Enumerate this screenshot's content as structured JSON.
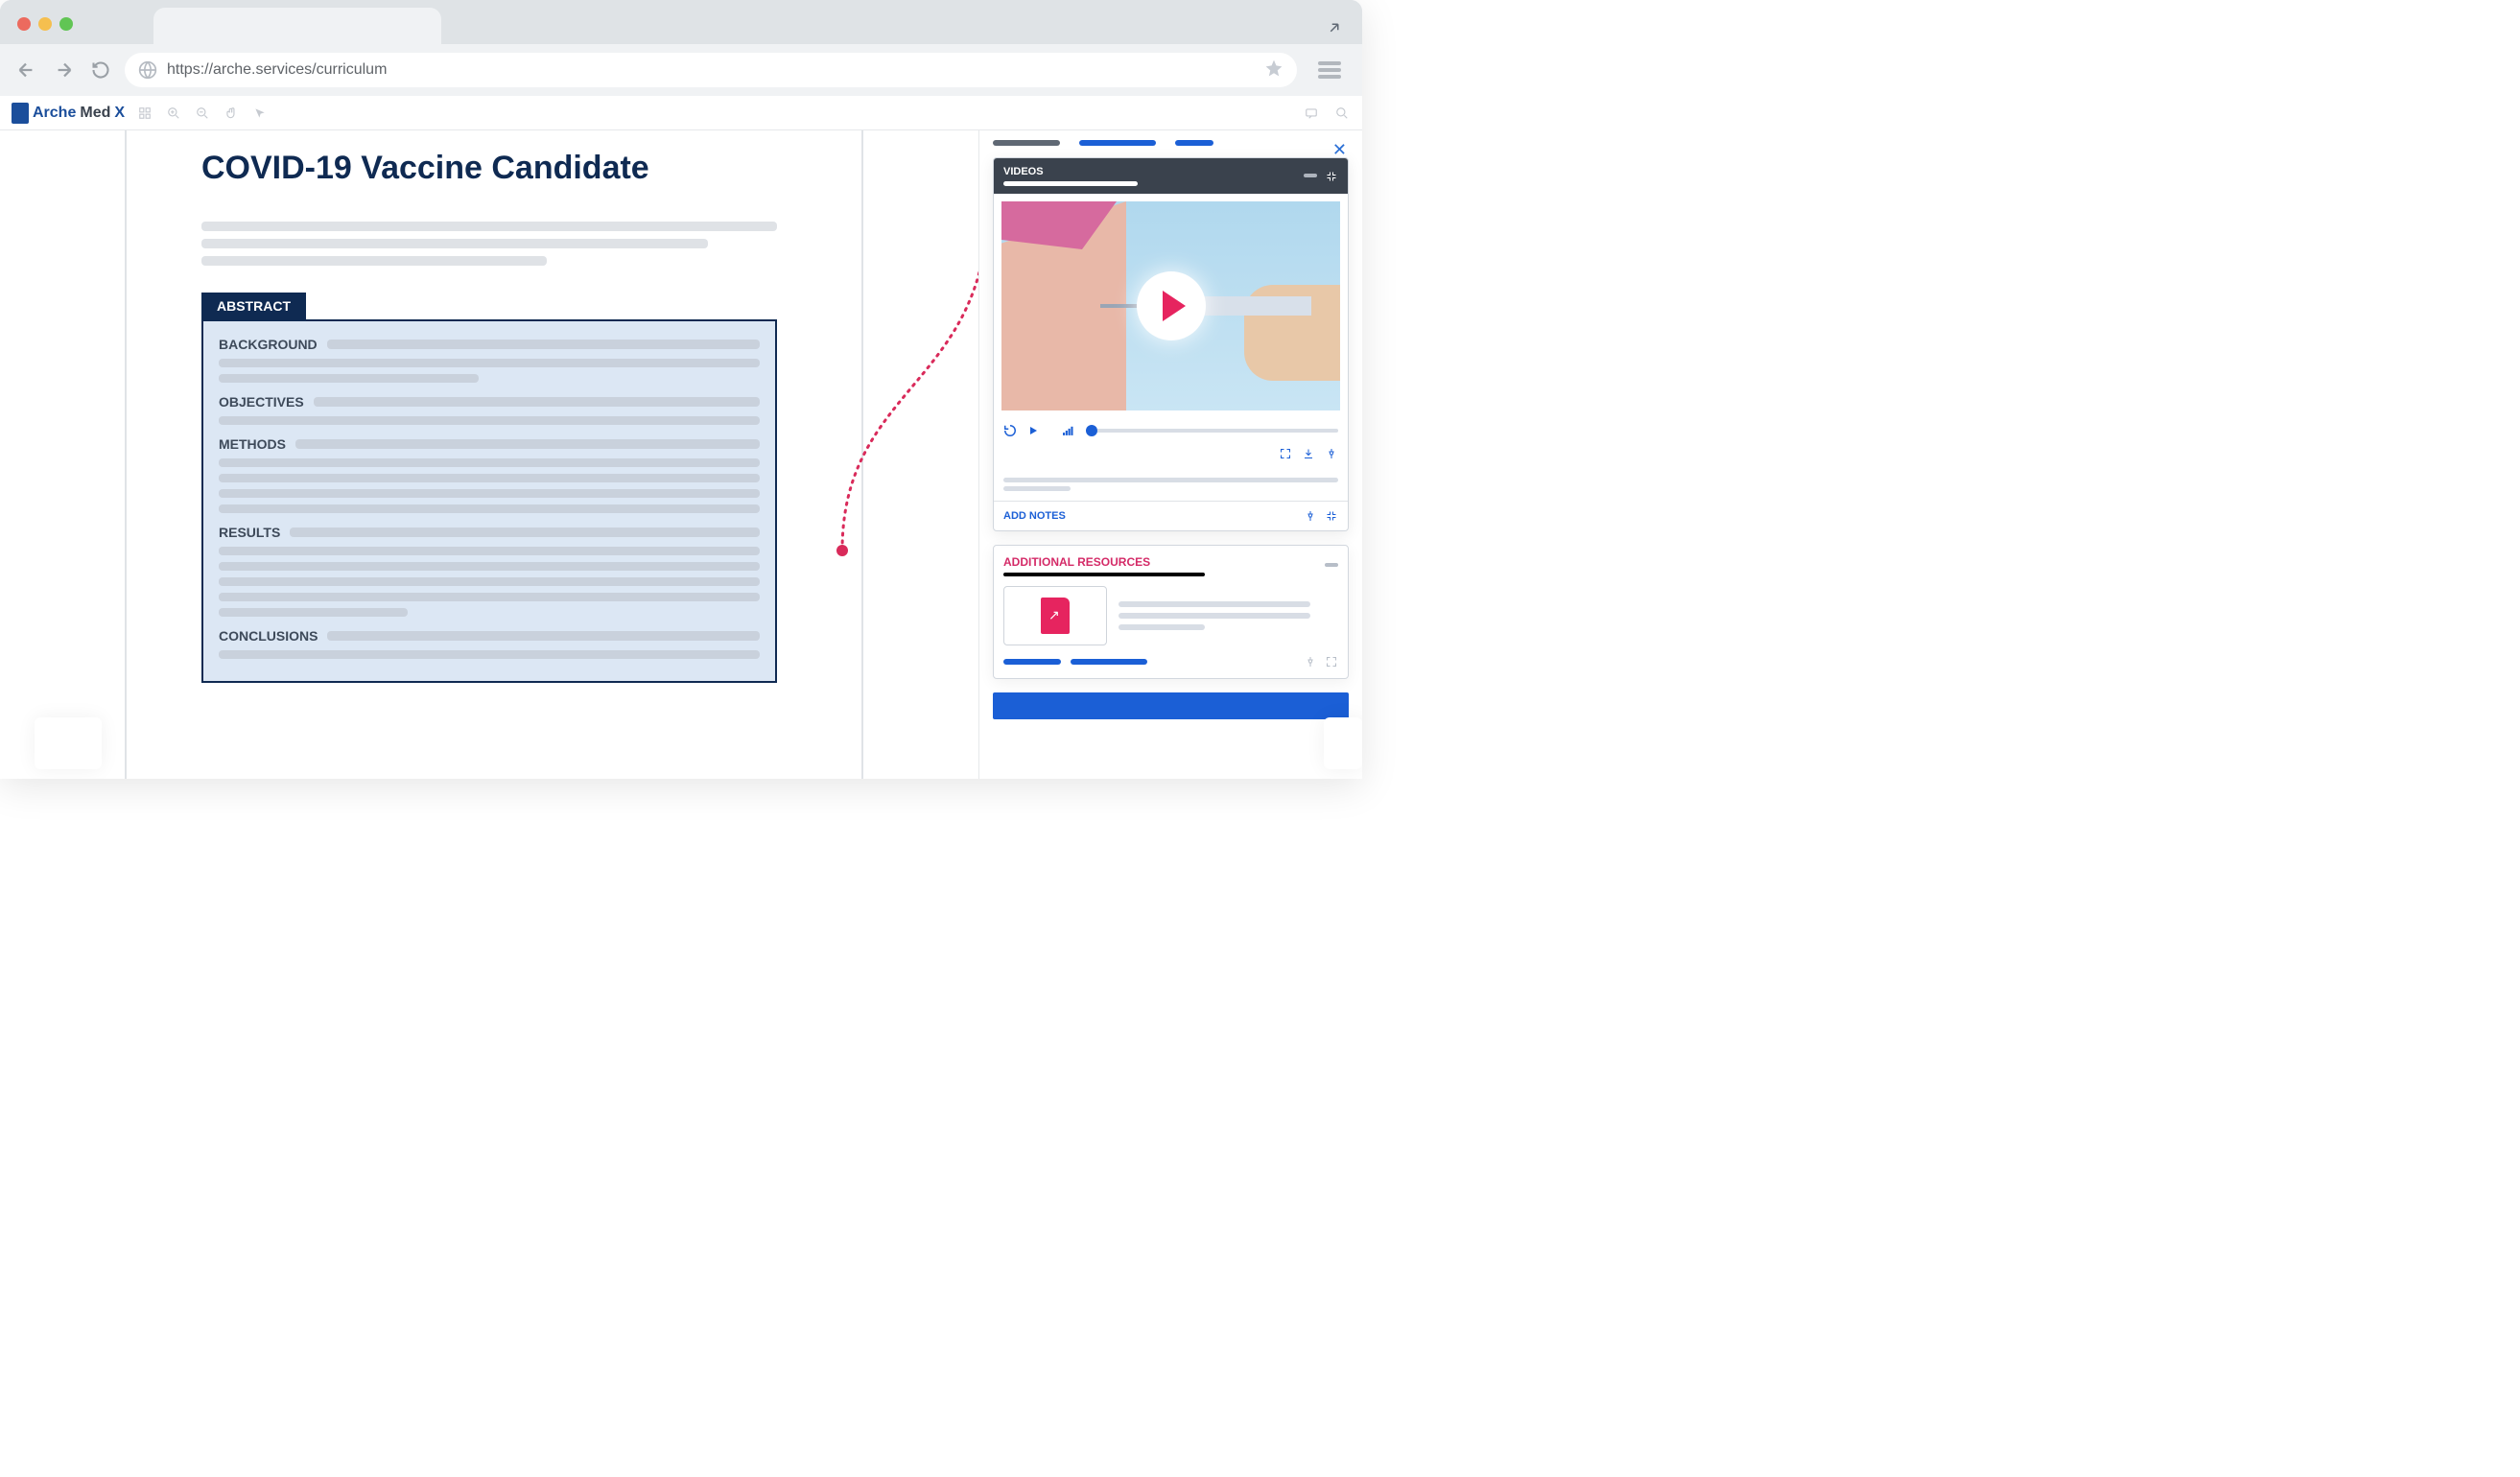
{
  "browser": {
    "url": "https://arche.services/curriculum"
  },
  "logo": {
    "prefix": "Arche",
    "mid": "Med",
    "suffix": "X"
  },
  "document": {
    "title": "COVID-19 Vaccine Candidate",
    "abstract_label": "ABSTRACT",
    "sections": {
      "background": "BACKGROUND",
      "objectives": "OBJECTIVES",
      "methods": "METHODS",
      "results": "RESULTS",
      "conclusions": "CONCLUSIONS"
    }
  },
  "sidebar": {
    "videos_label": "VIDEOS",
    "add_notes_label": "ADD NOTES",
    "additional_resources_label": "ADDITIONAL RESOURCES"
  }
}
